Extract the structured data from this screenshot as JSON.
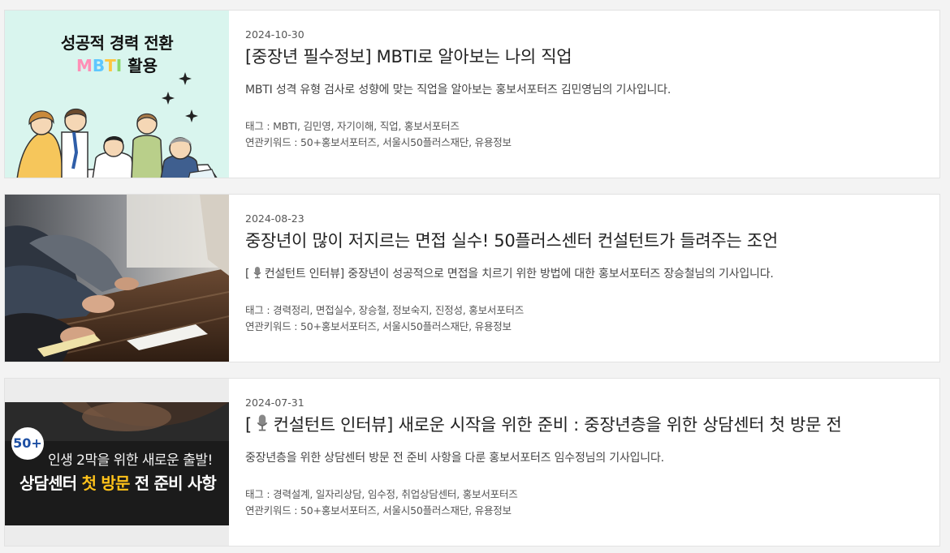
{
  "articles": [
    {
      "date": "2024-10-30",
      "title": "[중장년 필수정보] MBTI로 알아보는 나의 직업",
      "description": "MBTI 성격 유형 검사로 성향에 맞는 직업을 알아보는 홍보서포터즈 김민영님의 기사입니다.",
      "tags": "태그 : MBTI, 김민영, 자기이해, 직업, 홍보서포터즈",
      "keywords": "연관키워드 : 50+홍보서포터즈, 서울시50플러스재단, 유용정보",
      "thumb": {
        "line1": "성공적 경력 전환",
        "mbti": "MBTI",
        "line2_rest": " 활용"
      }
    },
    {
      "date": "2024-08-23",
      "title": "중장년이 많이 저지르는 면접 실수! 50플러스센터 컨설턴트가 들려주는 조언",
      "desc_prefix": "[",
      "desc_rest": " 컨설턴트 인터뷰] 중장년이 성공적으로 면접을 치르기 위한 방법에 대한 홍보서포터즈 장승철님의 기사입니다.",
      "tags": "태그 : 경력정리, 면접실수, 장승철, 정보숙지, 진정성, 홍보서포터즈",
      "keywords": "연관키워드 : 50+홍보서포터즈, 서울시50플러스재단, 유용정보"
    },
    {
      "date": "2024-07-31",
      "title_prefix": "[",
      "title_rest": " 컨설턴트 인터뷰] 새로운 시작을 위한 준비 : 중장년층을 위한 상담센터 첫 방문 전",
      "description": "중장년층을 위한 상담센터 방문 전 준비 사항을 다룬 홍보서포터즈 임수정님의 기사입니다.",
      "tags": "태그 : 경력설계, 일자리상담, 임수정, 취업상담센터, 홍보서포터즈",
      "keywords": "연관키워드 : 50+홍보서포터즈, 서울시50플러스재단, 유용정보",
      "thumb": {
        "badge": "50+",
        "line1": "인생 2막을 위한 새로운 출발!",
        "line2_a": "상담센터 ",
        "line2_hl": "첫 방문",
        "line2_b": " 전 준비 사항"
      }
    }
  ],
  "colors": {
    "background": "#f3f3f3",
    "card_border": "#e2e2e2",
    "thumb1_bg": "#d9f5ee",
    "highlight_yellow": "#ffc21a"
  },
  "icons": [
    "microphone-icon",
    "sparkle-icon"
  ]
}
